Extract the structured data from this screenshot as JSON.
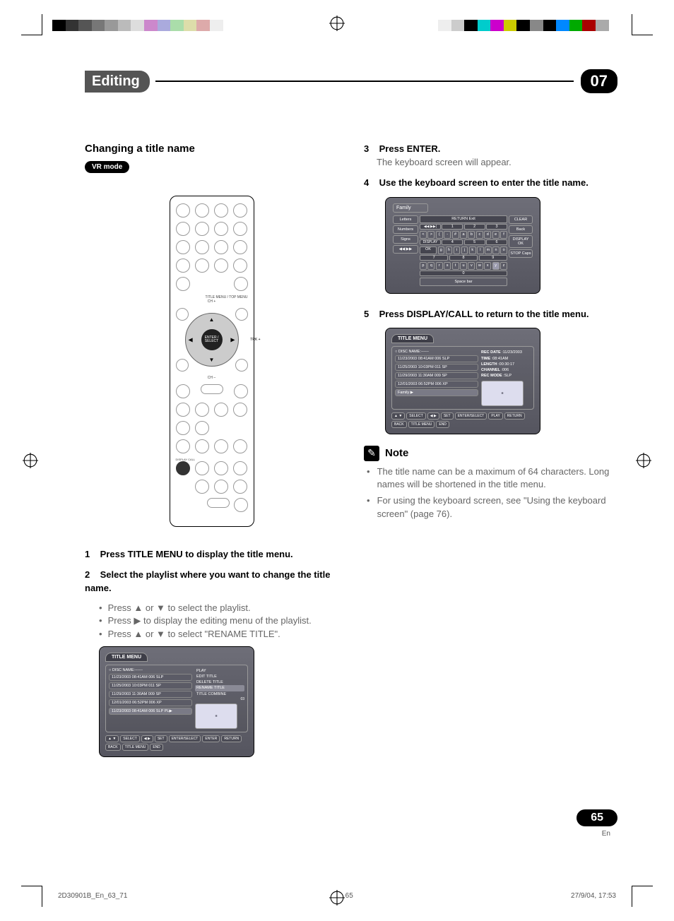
{
  "header": {
    "chapter_title": "Editing",
    "chapter_number": "07"
  },
  "left_col": {
    "heading": "Changing a title name",
    "vr_badge": "VR mode",
    "remote": {
      "title_menu": "TITLE MENU / TOP MENU",
      "ch_plus": "CH +",
      "ch_minus": "CH –",
      "trk": "TRK +",
      "enter": "ENTER / SELECT",
      "display_call": "DISPLAY CALL"
    },
    "step1": {
      "num": "1",
      "title": "Press TITLE MENU to display the title menu."
    },
    "step2": {
      "num": "2",
      "title": "Select the playlist where you want to change the title name.",
      "bullets": [
        "Press ▲ or ▼ to select the playlist.",
        "Press ▶ to display the editing menu of the playlist.",
        "Press ▲ or ▼ to select \"RENAME TITLE\"."
      ]
    },
    "osd1": {
      "tab": "TITLE MENU",
      "disc_label": "DISC NAME:------",
      "rows": [
        "11/23/2003 08:41AM 006 SLP",
        "11/25/2003 10:03PM 011 SP",
        "11/29/2003 11:30AM 009 SP",
        "12/01/2003 06:52PM 006 XP",
        "11/23/2003 08:41AM 006 SLP PL▶"
      ],
      "menu": [
        "PLAY",
        "EDIT TITLE",
        "DELETE TITLE",
        "RENAME TITLE",
        "TITLE COMBINE"
      ],
      "menu_sel": "RENAME TITLE",
      "side_tag": "03",
      "footer": [
        "▲ ▼",
        "SELECT",
        "◀ ▶",
        "SET",
        "ENTER/SELECT",
        "ENTER",
        "RETURN",
        "BACK",
        "TITLE MENU",
        "END"
      ]
    }
  },
  "right_col": {
    "step3": {
      "num": "3",
      "title": "Press ENTER.",
      "body": "The keyboard screen will appear."
    },
    "step4": {
      "num": "4",
      "title": "Use the keyboard screen to enter the title name."
    },
    "kb": {
      "field": "Family",
      "left_cells": [
        "Letters",
        "Numbers",
        "Signs",
        "◀◀  ▶▶"
      ],
      "right_cells": [
        "CLEAR",
        "Back",
        "DISPLAY OK",
        "STOP Caps"
      ],
      "row_top": [
        "RETURN Exit"
      ],
      "nums_groups": [
        "1",
        "2",
        "3"
      ],
      "keys": [
        "<",
        ">",
        "(",
        "-",
        "#",
        "a",
        "b",
        "c",
        "d",
        "e",
        "f"
      ],
      "mids_groups": [
        "4",
        "5",
        "6"
      ],
      "keys2_left": [
        "DISPLAY",
        "OK"
      ],
      "keys2": [
        "g",
        "h",
        "i",
        "j",
        "k",
        "l",
        "m",
        "n",
        "o"
      ],
      "lows_groups": [
        "7",
        "8",
        "9"
      ],
      "keys3": [
        "p",
        "q",
        "r",
        "s",
        "t",
        "u",
        "v",
        "w",
        "x",
        "y",
        "z"
      ],
      "highlight_key": "y",
      "zero": "0",
      "space": "Space bar"
    },
    "step5": {
      "num": "5",
      "title": "Press DISPLAY/CALL to return to the title menu."
    },
    "osd2": {
      "tab": "TITLE MENU",
      "disc_label": "DISC NAME:------",
      "rows": [
        "11/23/2003 08:41AM 006 SLP",
        "11/25/2003 10:03PM 011 SP",
        "11/29/2003 11:30AM 009 SP",
        "12/01/2003 06:52PM 006 XP",
        "Family"
      ],
      "sel_row": "Family",
      "info": [
        [
          "REC DATE",
          ":11/23/2003"
        ],
        [
          "TIME",
          ":08:41AM"
        ],
        [
          "LENGTH",
          ":00:30:17"
        ],
        [
          "CHANNEL",
          ":006"
        ],
        [
          "REC MODE",
          ":SLP"
        ]
      ],
      "footer": [
        "▲ ▼",
        "SELECT",
        "◀ ▶",
        "SET",
        "ENTER/SELECT",
        "PLAY",
        "RETURN",
        "BACK",
        "TITLE MENU",
        "END"
      ]
    },
    "note": {
      "title": "Note",
      "items": [
        "The title name can be a maximum of 64 characters. Long names will be shortened in the title menu.",
        "For using the keyboard screen, see \"Using the keyboard screen\" (page 76)."
      ]
    }
  },
  "page_footer": {
    "number": "65",
    "lang": "En",
    "file": "2D30901B_En_63_71",
    "page": "65",
    "date": "27/9/04, 17:53"
  },
  "print_colors_left": [
    "#000",
    "#333",
    "#555",
    "#777",
    "#999",
    "#bbb",
    "#ddd",
    "#c8c",
    "#aad",
    "#ada",
    "#dda",
    "#daa",
    "#eee",
    "#fff"
  ],
  "print_colors_right": [
    "#eee",
    "#ccc",
    "#000",
    "#0cc",
    "#c0c",
    "#cc0",
    "#000",
    "#888",
    "#000",
    "#08f",
    "#0a0",
    "#a00",
    "#aaa",
    "#fff"
  ]
}
